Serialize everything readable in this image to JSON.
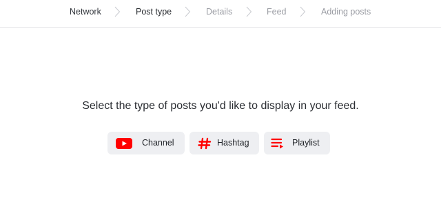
{
  "stepper": {
    "steps": [
      {
        "label": "Network",
        "state": "done"
      },
      {
        "label": "Post type",
        "state": "active"
      },
      {
        "label": "Details",
        "state": "future"
      },
      {
        "label": "Feed",
        "state": "future"
      },
      {
        "label": "Adding posts",
        "state": "future"
      }
    ],
    "separator_icon": "chevron-right-icon"
  },
  "main": {
    "prompt": "Select the type of posts you'd like to display in your feed.",
    "options": [
      {
        "label": "Channel",
        "icon": "youtube-icon"
      },
      {
        "label": "Hashtag",
        "icon": "hashtag-icon"
      },
      {
        "label": "Playlist",
        "icon": "playlist-icon"
      }
    ]
  },
  "colors": {
    "accent": "#ff0000",
    "option_bg": "#eeeff2",
    "inactive_step": "#9a9ca3"
  }
}
